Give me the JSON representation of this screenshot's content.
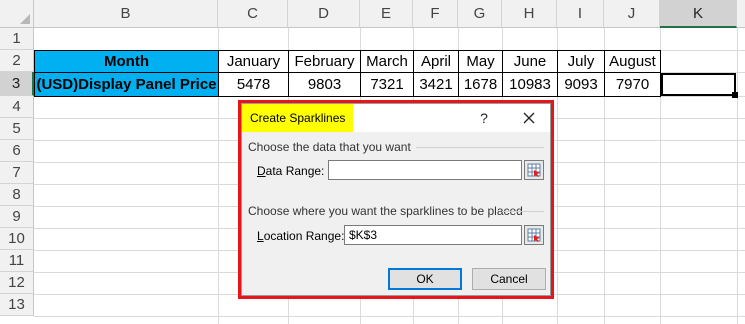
{
  "columns": [
    "B",
    "C",
    "D",
    "E",
    "F",
    "G",
    "H",
    "I",
    "J",
    "K"
  ],
  "selected_column": "K",
  "rows": [
    "1",
    "2",
    "3",
    "4",
    "5",
    "6",
    "7",
    "8",
    "9",
    "10",
    "11",
    "12",
    "13"
  ],
  "selected_row": "3",
  "table": {
    "header": [
      "Month",
      "January",
      "February",
      "March",
      "April",
      "May",
      "June",
      "July",
      "August"
    ],
    "values": [
      "(USD)Display Panel Price",
      "5478",
      "9803",
      "7321",
      "3421",
      "1678",
      "10983",
      "9093",
      "7970"
    ]
  },
  "colors": {
    "header_fill": "#00b0f0",
    "dialog_highlight": "#e8141c",
    "title_highlight": "#ffff00"
  },
  "dialog": {
    "title": "Create Sparklines",
    "help": "?",
    "section_data": "Choose the data that you want",
    "data_range_label": "Data Range:",
    "data_range_value": "",
    "section_location": "Choose where you want the sparklines to be placed",
    "location_range_label": "Location Range:",
    "location_range_value": "$K$3",
    "ok_label": "OK",
    "cancel_label": "Cancel",
    "icons": [
      "close-icon",
      "collapse-dialog-icon"
    ]
  }
}
